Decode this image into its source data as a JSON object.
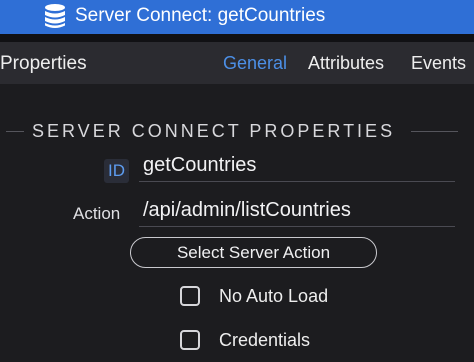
{
  "titlebar": {
    "title": "Server Connect: getCountries",
    "icon": "database-icon"
  },
  "header": {
    "panel_title": "Properties",
    "tabs": [
      {
        "label": "General",
        "active": true
      },
      {
        "label": "Attributes",
        "active": false
      },
      {
        "label": "Events",
        "active": false
      }
    ]
  },
  "section": {
    "title": "SERVER CONNECT PROPERTIES"
  },
  "fields": {
    "id": {
      "label": "ID",
      "value": "getCountries"
    },
    "action": {
      "label": "Action",
      "value": "/api/admin/listCountries"
    }
  },
  "select_action_button": "Select Server Action",
  "checkboxes": [
    {
      "label": "No Auto Load",
      "checked": false
    },
    {
      "label": "Credentials",
      "checked": false
    }
  ],
  "colors": {
    "accent": "#4c8fe6",
    "titlebar": "#2f6fd6",
    "background": "#1c1c1f"
  }
}
